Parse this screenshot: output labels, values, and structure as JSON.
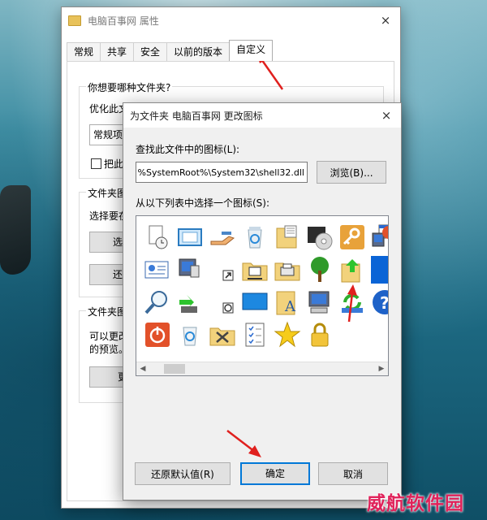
{
  "properties_window": {
    "title": "电脑百事网 属性",
    "close_icon": "×",
    "tabs": [
      {
        "label": "常规",
        "active": false
      },
      {
        "label": "共享",
        "active": false
      },
      {
        "label": "安全",
        "active": false
      },
      {
        "label": "以前的版本",
        "active": false
      },
      {
        "label": "自定义",
        "active": true
      }
    ],
    "group1": {
      "label": "你想要哪种文件夹?",
      "optimize_label": "优化此文件夹(T):",
      "optimize_value": "常规项",
      "subfolder_checkbox_label": "把此"
    },
    "group2": {
      "label": "文件夹图",
      "description": "选择要在",
      "choose_button": "选择",
      "restore_button": "还原"
    },
    "group3": {
      "label": "文件夹图",
      "description_line1": "可以更改",
      "description_line2": "的预览。",
      "change_button": "更"
    }
  },
  "change_icon_dialog": {
    "title": "为文件夹 电脑百事网 更改图标",
    "close_icon": "×",
    "find_label": "查找此文件中的图标(L):",
    "path_value": "%SystemRoot%\\System32\\shell32.dll",
    "browse_button": "浏览(B)...",
    "list_label": "从以下列表中选择一个图标(S):",
    "icons": [
      {
        "name": "clock-document-icon",
        "selected": false
      },
      {
        "name": "window-frame-icon",
        "selected": false
      },
      {
        "name": "hand-share-icon",
        "selected": false
      },
      {
        "name": "recycle-bin-full-icon",
        "selected": false
      },
      {
        "name": "calculator-folder-icon",
        "selected": false
      },
      {
        "name": "cd-drive-icon",
        "selected": false
      },
      {
        "name": "key-icon",
        "selected": false
      },
      {
        "name": "window-computer-icon",
        "selected": false
      },
      {
        "name": "id-card-icon",
        "selected": false
      },
      {
        "name": "monitor-remote-icon",
        "selected": false
      },
      {
        "name": "shortcut-arrow-icon",
        "selected": false
      },
      {
        "name": "network-folder-icon",
        "selected": false
      },
      {
        "name": "printer-folder-icon",
        "selected": false
      },
      {
        "name": "tree-icon",
        "selected": false
      },
      {
        "name": "folder-up-arrow-icon",
        "selected": false
      },
      {
        "name": "blank-icon",
        "selected": true
      },
      {
        "name": "magnifier-icon",
        "selected": false
      },
      {
        "name": "usb-drive-icon",
        "selected": false
      },
      {
        "name": "timer-shortcut-icon",
        "selected": false
      },
      {
        "name": "blue-screen-icon",
        "selected": false
      },
      {
        "name": "font-folder-icon",
        "selected": false
      },
      {
        "name": "computer-icon",
        "selected": false
      },
      {
        "name": "sync-icon",
        "selected": false
      },
      {
        "name": "help-icon",
        "selected": false
      },
      {
        "name": "power-icon",
        "selected": false
      },
      {
        "name": "recycle-bin-empty-icon",
        "selected": false
      },
      {
        "name": "tools-folder-icon",
        "selected": false
      },
      {
        "name": "checklist-icon",
        "selected": false
      },
      {
        "name": "star-icon",
        "selected": false
      },
      {
        "name": "padlock-icon",
        "selected": false
      }
    ],
    "restore_default_button": "还原默认值(R)",
    "ok_button": "确定",
    "cancel_button": "取消"
  },
  "watermark": "威航软件园",
  "colors": {
    "accent": "#0078d7",
    "selected_icon": "#0a64d6",
    "annotation_arrow": "#e0201e",
    "watermark": "#e0225a"
  }
}
